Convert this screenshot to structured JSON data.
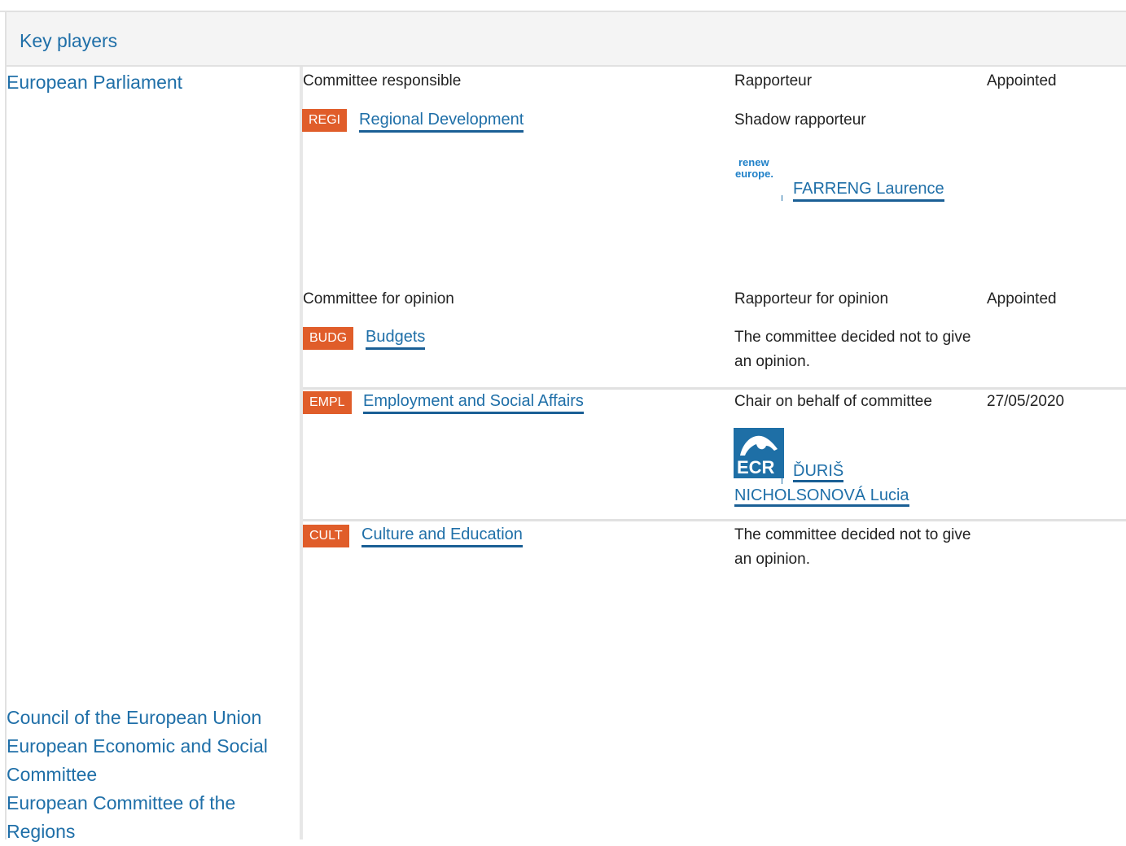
{
  "section_title": "Key players",
  "institutions": {
    "ep": "European Parliament",
    "council": "Council of the European Union",
    "eesc": "European Economic and Social Committee",
    "cor": "European Committee of the Regions"
  },
  "responsible": {
    "header_committee": "Committee responsible",
    "header_rapporteur": "Rapporteur",
    "header_appointed": "Appointed",
    "committee_code": "REGI",
    "committee_name": "Regional Development",
    "shadow_label": "Shadow rapporteur",
    "shadow_group_logo": "renew europe.",
    "shadow_name": "FARRENG Laurence"
  },
  "opinion": {
    "header_committee": "Committee for opinion",
    "header_rapporteur": "Rapporteur for opinion",
    "header_appointed": "Appointed",
    "rows": [
      {
        "code": "BUDG",
        "name": "Budgets",
        "rapporteur": "The committee decided not to give an opinion.",
        "appointed": ""
      },
      {
        "code": "EMPL",
        "name": "Employment and Social Affairs",
        "rapporteur": "Chair on behalf of committee",
        "appointed": "27/05/2020",
        "group_logo": "ECR",
        "person": "ĎURIŠ NICHOLSONOVÁ Lucia"
      },
      {
        "code": "CULT",
        "name": "Culture and Education",
        "rapporteur": "The committee decided not to give an opinion.",
        "appointed": ""
      }
    ]
  },
  "colors": {
    "link": "#1f6fa8",
    "badge": "#e05d2a",
    "header_bg": "#f4f4f4"
  }
}
